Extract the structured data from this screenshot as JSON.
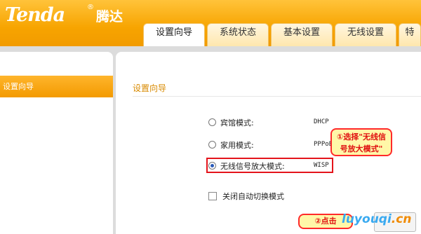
{
  "brand": {
    "logo_text": "Tenda",
    "logo_cn": "腾达",
    "reg_mark": "®"
  },
  "tabs": [
    {
      "label": "设置向导",
      "active": true
    },
    {
      "label": "系统状态",
      "active": false
    },
    {
      "label": "基本设置",
      "active": false
    },
    {
      "label": "无线设置",
      "active": false
    },
    {
      "label": "特",
      "active": false
    }
  ],
  "sidebar": {
    "items": [
      {
        "label": "设置向导",
        "active": true
      }
    ]
  },
  "main": {
    "title": "设置向导",
    "modes": [
      {
        "label": "宾馆模式:",
        "value": "DHCP",
        "checked": false
      },
      {
        "label": "家用模式:",
        "value": "PPPoE",
        "checked": false
      },
      {
        "label": "无线信号放大模式:",
        "value": "WISP",
        "checked": true
      }
    ],
    "auto_switch_label": "关闭自动切换模式",
    "auto_switch_checked": false
  },
  "annotations": {
    "callout1_line1": "①选择\"无线信",
    "callout1_line2": "号放大模式\"",
    "callout2": "②点击",
    "watermark_a": "luyouqi",
    "watermark_b": ".cn"
  },
  "colors": {
    "accent": "#f7a400",
    "highlight_red": "#e4141b"
  }
}
